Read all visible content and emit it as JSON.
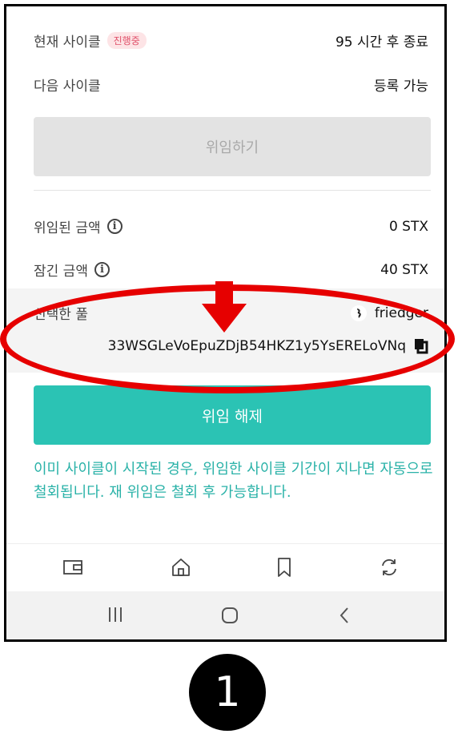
{
  "cycle": {
    "current_label": "현재 사이클",
    "current_badge": "진행중",
    "current_value": "95 시간 후 종료",
    "next_label": "다음 사이클",
    "next_value": "등록 가능"
  },
  "delegate_button": "위임하기",
  "amounts": {
    "delegated_label": "위임된 금액",
    "delegated_value": "0 STX",
    "locked_label": "잠긴 금액",
    "locked_value": "40 STX"
  },
  "pool": {
    "label": "선택한 풀",
    "name": "friedger",
    "address": "33WSGLeVoEpuZDjB54HKZ1y5YsERELoVNq"
  },
  "revoke_button": "위임 해제",
  "notice": "이미 사이클이 시작된 경우, 위임한 사이클 기간이 지나면 자동으로 철회됩니다. 재 위임은 철회 후 가능합니다.",
  "nav": {
    "items": [
      "wallet-icon",
      "home-icon",
      "bookmark-icon",
      "sync-icon"
    ]
  },
  "colors": {
    "accent": "#2bc3b4",
    "badge_bg": "#fde4e6",
    "badge_text": "#e0516a",
    "annotation_red": "#e60000"
  },
  "annotation": {
    "step_number": "1"
  }
}
